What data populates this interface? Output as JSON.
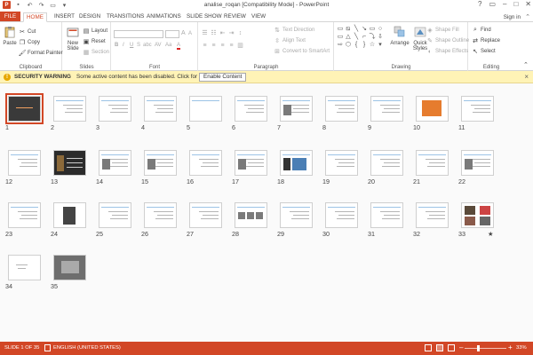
{
  "window": {
    "title": "analise_roqan [Compatibility Mode] - PowerPoint",
    "app_badge": "P",
    "qat": [
      "save-icon",
      "undo-icon",
      "redo-icon",
      "slideshow-icon",
      "customize-icon"
    ],
    "controls": {
      "help": "?",
      "restore": "▭",
      "minimize": "–",
      "maximize": "□",
      "close": "✕"
    }
  },
  "tabs": [
    "FILE",
    "HOME",
    "INSERT",
    "DESIGN",
    "TRANSITIONS",
    "ANIMATIONS",
    "SLIDE SHOW",
    "REVIEW",
    "VIEW"
  ],
  "active_tab": "HOME",
  "signin": "Sign in",
  "ribbon": {
    "clipboard": {
      "label": "Clipboard",
      "paste": "Paste",
      "cut": "Cut",
      "copy": "Copy",
      "format_painter": "Format Painter"
    },
    "slides": {
      "label": "Slides",
      "new_slide": "New Slide",
      "layout": "Layout",
      "reset": "Reset",
      "section": "Section"
    },
    "font": {
      "label": "Font",
      "font_name": "",
      "font_size": "",
      "grow": "A",
      "shrink": "A",
      "bold": "B",
      "italic": "I",
      "underline": "U",
      "strike": "S",
      "shadow": "abc",
      "spacing": "AV",
      "case": "Aa",
      "color": "A"
    },
    "paragraph": {
      "label": "Paragraph",
      "text_direction": "Text Direction",
      "align_text": "Align Text",
      "convert_smartart": "Convert to SmartArt"
    },
    "drawing": {
      "label": "Drawing",
      "arrange": "Arrange",
      "quick_styles": "Quick Styles",
      "shape_fill": "Shape Fill",
      "shape_outline": "Shape Outline",
      "shape_effects": "Shape Effects",
      "shapes": [
        "▭",
        "⧅",
        "╲",
        "↘",
        "▭",
        "○",
        "▭",
        "△",
        "╲",
        "⌐",
        "⤵",
        "⇩",
        "⇨",
        "⬡",
        "{",
        "}",
        "☆",
        "▾"
      ]
    },
    "editing": {
      "label": "Editing",
      "find": "Find",
      "replace": "Replace",
      "select": "Select"
    }
  },
  "security_warning": {
    "title": "SECURITY WARNING",
    "message": "Some active content has been disabled. Click for more details.",
    "button": "Enable Content",
    "close": "×"
  },
  "slides": [
    {
      "n": "1",
      "k": "dark-orange"
    },
    {
      "n": "2",
      "k": "text"
    },
    {
      "n": "3",
      "k": "text"
    },
    {
      "n": "4",
      "k": "text"
    },
    {
      "n": "5",
      "k": "blank"
    },
    {
      "n": "6",
      "k": "text"
    },
    {
      "n": "7",
      "k": "img"
    },
    {
      "n": "8",
      "k": "text"
    },
    {
      "n": "9",
      "k": "text"
    },
    {
      "n": "10",
      "k": "orange"
    },
    {
      "n": "11",
      "k": "text"
    },
    {
      "n": "12",
      "k": "text"
    },
    {
      "n": "13",
      "k": "dark"
    },
    {
      "n": "14",
      "k": "img"
    },
    {
      "n": "15",
      "k": "img"
    },
    {
      "n": "16",
      "k": "text"
    },
    {
      "n": "17",
      "k": "img"
    },
    {
      "n": "18",
      "k": "blue-img"
    },
    {
      "n": "19",
      "k": "text"
    },
    {
      "n": "20",
      "k": "text"
    },
    {
      "n": "21",
      "k": "text"
    },
    {
      "n": "22",
      "k": "img"
    },
    {
      "n": "23",
      "k": "text"
    },
    {
      "n": "24",
      "k": "dark-small"
    },
    {
      "n": "25",
      "k": "text"
    },
    {
      "n": "26",
      "k": "text"
    },
    {
      "n": "27",
      "k": "text"
    },
    {
      "n": "28",
      "k": "img-row"
    },
    {
      "n": "29",
      "k": "text"
    },
    {
      "n": "30",
      "k": "text"
    },
    {
      "n": "31",
      "k": "text"
    },
    {
      "n": "32",
      "k": "text"
    },
    {
      "n": "33",
      "k": "photos"
    },
    {
      "n": "34",
      "k": "text-small"
    },
    {
      "n": "35",
      "k": "photo"
    }
  ],
  "selected_slide": "1",
  "status": {
    "slide_of": "SLIDE 1 OF 35",
    "language": "ENGLISH (UNITED STATES)",
    "zoom_minus": "–",
    "zoom_plus": "+",
    "zoom": "33%",
    "zoom_level": 0.33
  }
}
